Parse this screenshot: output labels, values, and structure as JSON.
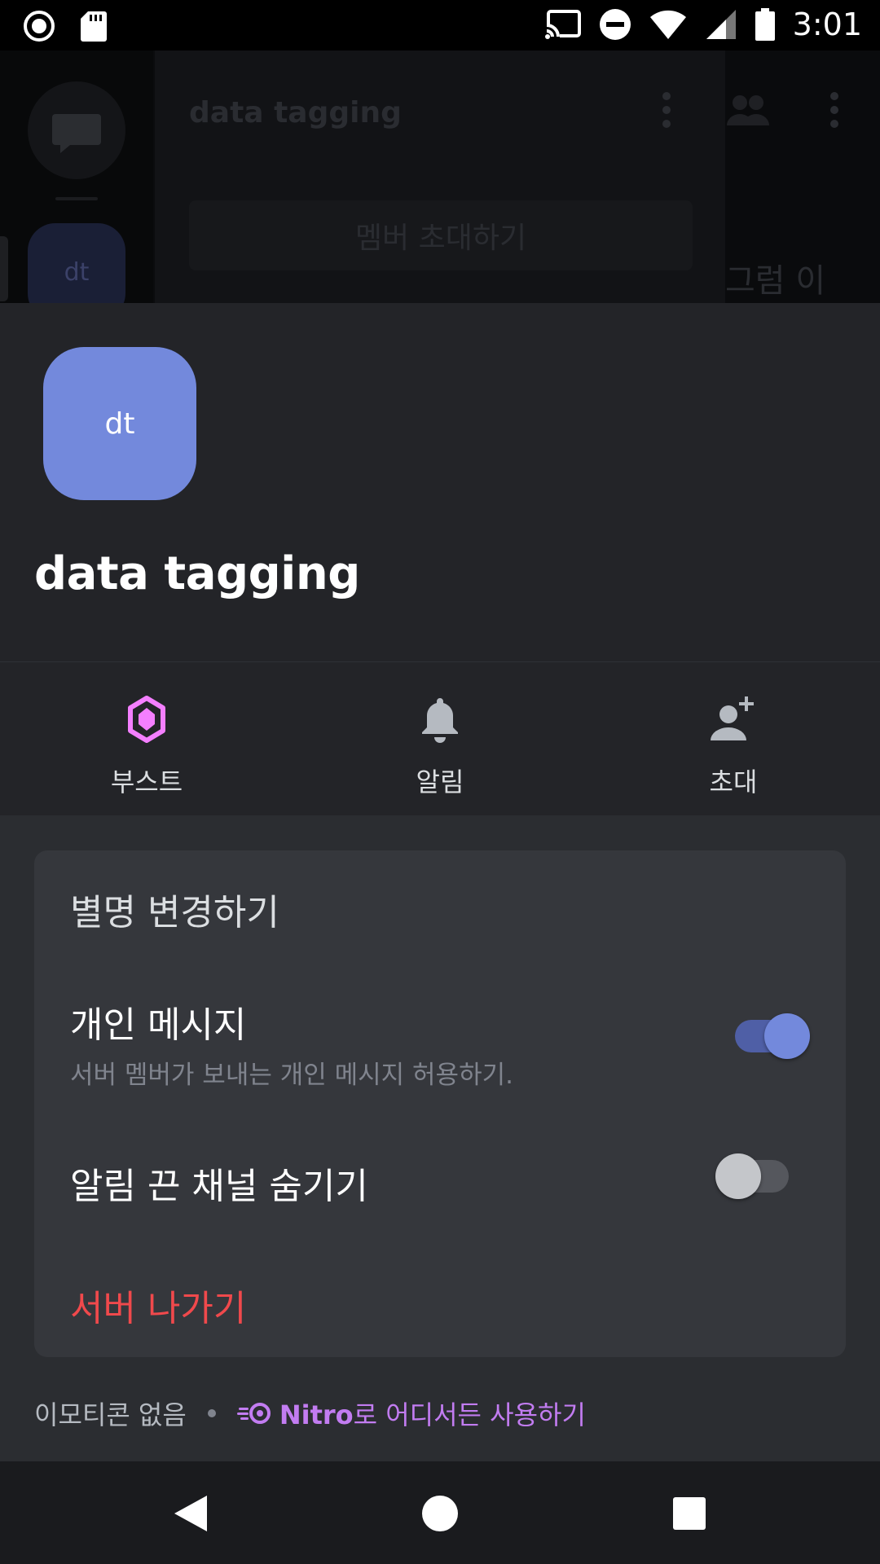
{
  "status_bar": {
    "time": "3:01",
    "left_icons": [
      "record-icon",
      "sd-card-icon"
    ],
    "right_icons": [
      "cast-icon",
      "do-not-disturb-icon",
      "wifi-icon",
      "signal-icon",
      "battery-icon"
    ]
  },
  "background": {
    "channel_title": "data tagging",
    "invite_button": "멤버 초대하기",
    "server_abbrev": "dt",
    "chat_preview": "그럼 이"
  },
  "sheet": {
    "server_avatar_text": "dt",
    "server_name": "data tagging",
    "actions": [
      {
        "label": "부스트",
        "icon": "boost-icon",
        "color": "#f47fff"
      },
      {
        "label": "알림",
        "icon": "bell-icon",
        "color": "#b5bac1"
      },
      {
        "label": "초대",
        "icon": "add-member-icon",
        "color": "#b5bac1"
      }
    ],
    "settings": {
      "nickname": "별명 변경하기",
      "dm_title": "개인 메시지",
      "dm_subtitle": "서버 멤버가 보내는 개인 메시지 허용하기.",
      "dm_enabled": true,
      "hide_muted": "알림 끈 채널 숨기기",
      "hide_muted_enabled": false,
      "leave_server": "서버 나가기"
    },
    "footer": {
      "no_emoji": "이모티콘 없음",
      "nitro_bold": "Nitro",
      "nitro_rest": "로 어디서든 사용하기"
    }
  },
  "colors": {
    "accent": "#7389dc",
    "danger": "#f0494c",
    "nitro": "#c27cf1"
  },
  "nav_bar": {
    "buttons": [
      "back-icon",
      "home-icon",
      "recents-icon"
    ]
  }
}
